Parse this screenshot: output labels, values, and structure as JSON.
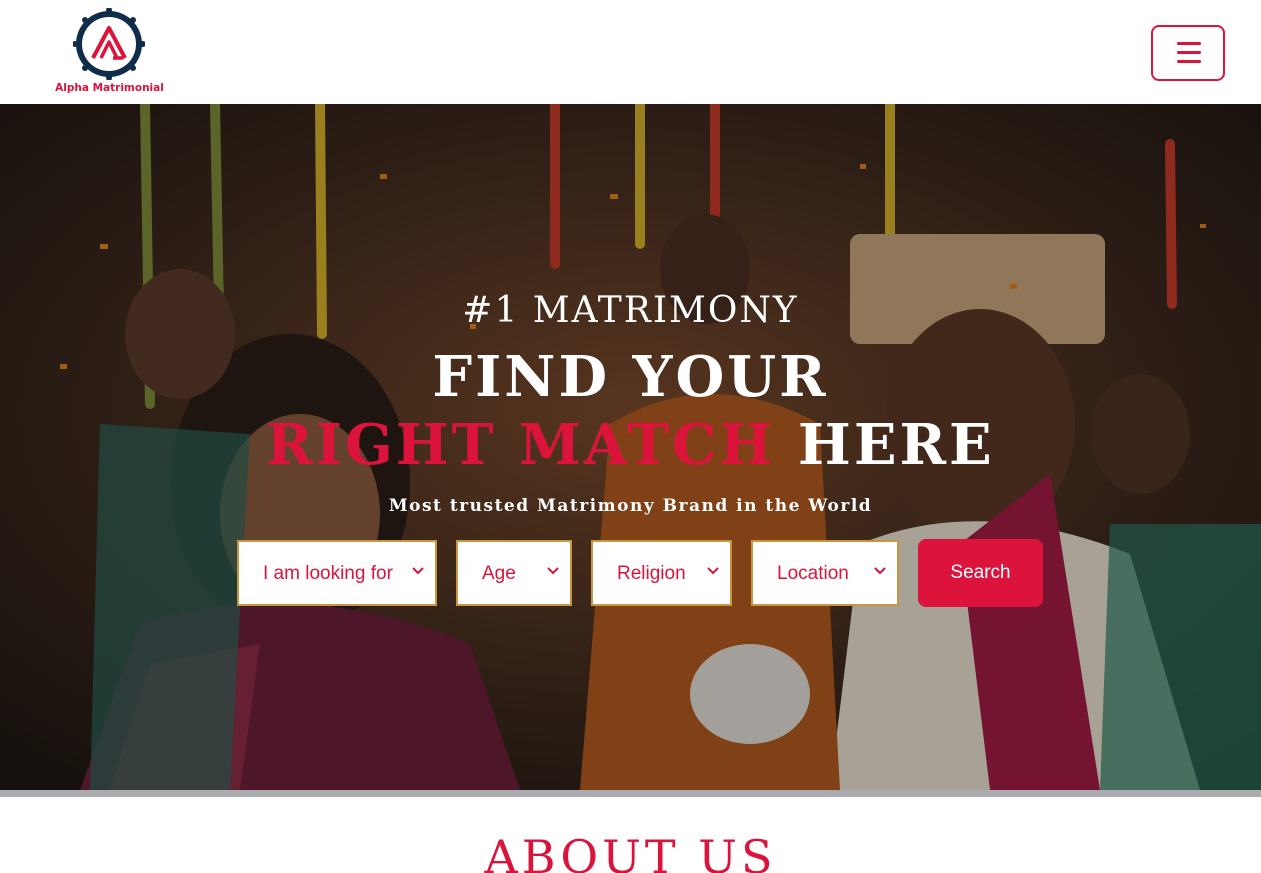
{
  "brand": {
    "name": "Alpha Matrimonial",
    "accent_color": "#dc143c",
    "logo_ring_color": "#0f2d4a"
  },
  "header": {
    "menu_icon": "hamburger-menu-icon"
  },
  "hero": {
    "eyebrow": "#1 MATRIMONY",
    "headline_line1": "FIND YOUR",
    "headline_accent": "RIGHT MATCH",
    "headline_rest": "HERE",
    "tagline": "Most trusted Matrimony Brand in the World"
  },
  "search": {
    "looking_for": "I am looking for",
    "age": "Age",
    "religion": "Religion",
    "location": "Location",
    "button_label": "Search",
    "field_border_color": "#c8963e",
    "chevron_icon": "chevron-down-icon"
  },
  "about": {
    "heading": "ABOUT US"
  }
}
